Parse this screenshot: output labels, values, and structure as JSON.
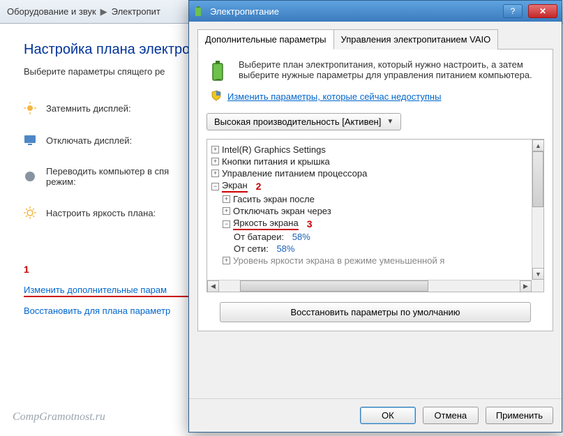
{
  "bg": {
    "breadcrumb": {
      "part1": "Оборудование и звук",
      "part2": "Электропит"
    },
    "title": "Настройка плана электро",
    "subtitle": "Выберите параметры спящего ре",
    "rows": {
      "dim": "Затемнить дисплей:",
      "off": "Отключать дисплей:",
      "sleep": "Переводить компьютер в спя\nрежим:",
      "brightness": "Настроить яркость плана:"
    },
    "links": {
      "advanced": "Изменить дополнительные парам",
      "restore": "Восстановить для плана параметр"
    },
    "annot1": "1",
    "watermark": "CompGramotnost.ru"
  },
  "dlg": {
    "title": "Электропитание",
    "tabs": {
      "t1": "Дополнительные параметры",
      "t2": "Управления электропитанием VAIO"
    },
    "intro": "Выберите план электропитания, который нужно настроить, а затем выберите нужные параметры для управления питанием компьютера.",
    "uac_link": "Изменить параметры, которые сейчас недоступны",
    "plan": "Высокая производительность [Активен]",
    "tree": {
      "n1": "Intel(R) Graphics Settings",
      "n2": "Кнопки питания и крышка",
      "n3": "Управление питанием процессора",
      "n4": "Экран",
      "annot2": "2",
      "n4a": "Гасить экран после",
      "n4b": "Отключать экран через",
      "n4c": "Яркость экрана",
      "annot3": "3",
      "n4c1_label": "От батареи:",
      "n4c1_val": "58%",
      "n4c2_label": "От сети:",
      "n4c2_val": "58%",
      "n4d_cut": "Уровень яркости экрана в режиме уменьшенной я"
    },
    "restore_defaults": "Восстановить параметры по умолчанию",
    "buttons": {
      "ok": "ОК",
      "cancel": "Отмена",
      "apply": "Применить"
    }
  }
}
